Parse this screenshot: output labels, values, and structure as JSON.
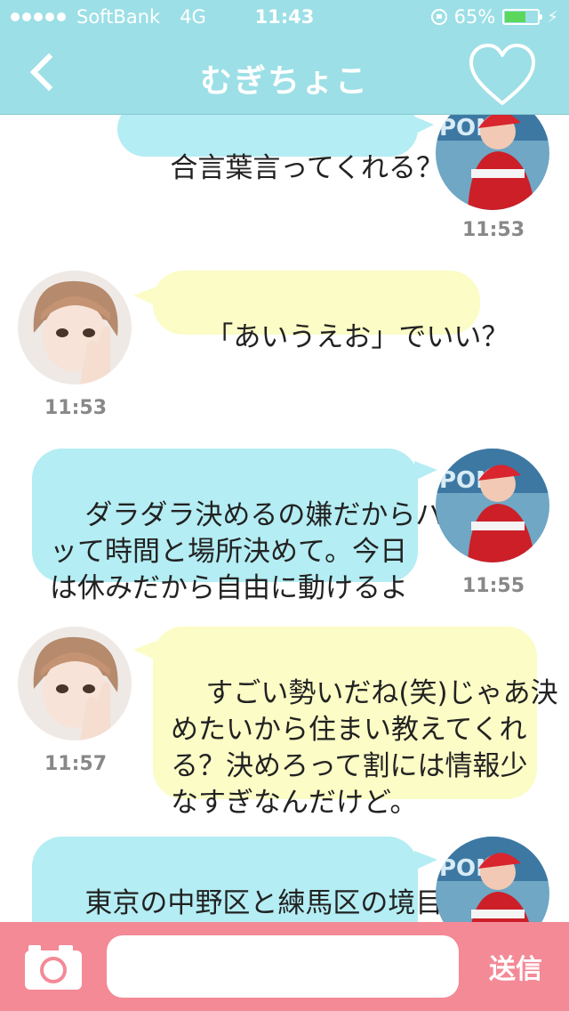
{
  "status_bar": {
    "carrier": "SoftBank",
    "network": "4G",
    "time": "11:43",
    "battery": "65%",
    "battery_level": 0.65
  },
  "header": {
    "title": "むぎちょこ",
    "back_icon": "chevron-left-icon",
    "favorite_icon": "heart-outline-icon"
  },
  "messages": [
    {
      "side": "right",
      "text": "合言葉言ってくれる？",
      "time": "11:53"
    },
    {
      "side": "left",
      "text": "「あいうえお」でいい？",
      "time": "11:53"
    },
    {
      "side": "right",
      "text": "ダラダラ決めるの嫌だからパ\nッて時間と場所決めて。今日\nは休みだから自由に動けるよ",
      "time": "11:55"
    },
    {
      "side": "left",
      "text": "すごい勢いだね(笑)じゃあ決\nめたいから住まい教えてくれ\nる？決めろって割には情報少\nなすぎなんだけど。",
      "time": "11:57"
    },
    {
      "side": "right",
      "text": "東京の中野区と練馬区の境目\nくらいだよ。すれ違いで連絡",
      "time": ""
    }
  ],
  "composer": {
    "camera_icon": "camera-icon",
    "input_value": "",
    "input_placeholder": "",
    "send_label": "送信"
  },
  "colors": {
    "header": "#9cdfe6",
    "my_bubble": "#b4edf3",
    "their_bubble": "#fbfcc6",
    "bottom_bar": "#f38a96"
  }
}
